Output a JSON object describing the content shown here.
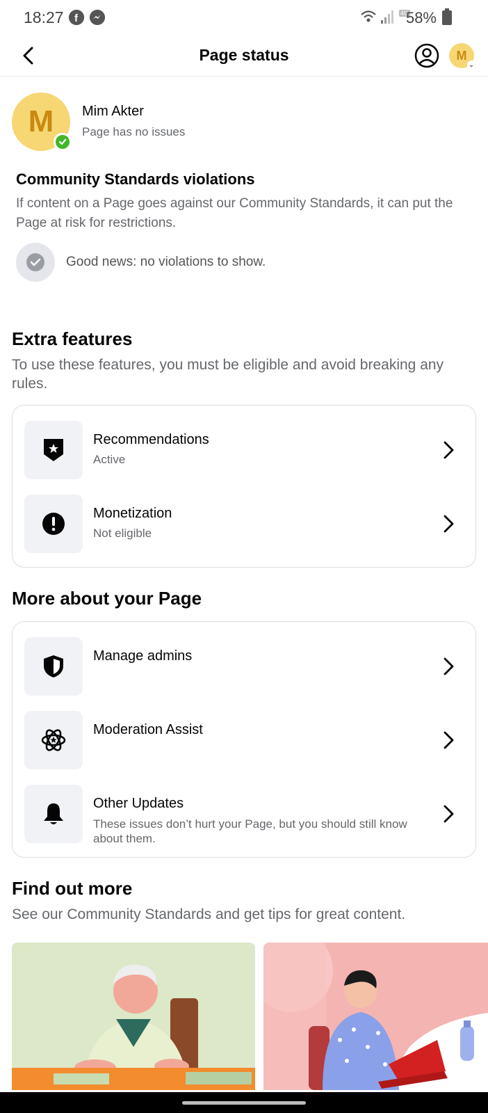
{
  "status_bar": {
    "time": "18:27",
    "battery_percent": "58%",
    "network_badge": "4G"
  },
  "nav": {
    "title": "Page status",
    "avatar_letter": "M"
  },
  "page": {
    "avatar_letter": "M",
    "name": "Mim Akter",
    "status": "Page has no issues"
  },
  "violations": {
    "title": "Community Standards violations",
    "description": "If content on a Page goes against our Community Standards, it can put the Page at risk for restrictions.",
    "empty_message": "Good news: no violations to show."
  },
  "extra_features": {
    "title": "Extra features",
    "description": "To use these features, you must be eligible and avoid breaking any rules.",
    "items": [
      {
        "title": "Recommendations",
        "subtitle": "Active",
        "icon": "star-shield-icon"
      },
      {
        "title": "Monetization",
        "subtitle": "Not eligible",
        "icon": "exclamation-circle-icon"
      }
    ]
  },
  "more_about": {
    "title": "More about your Page",
    "items": [
      {
        "title": "Manage admins",
        "subtitle": "",
        "icon": "shield-icon"
      },
      {
        "title": "Moderation Assist",
        "subtitle": "",
        "icon": "atom-star-icon"
      },
      {
        "title": "Other Updates",
        "subtitle": "These issues don’t hurt your Page, but you should still know about them.",
        "icon": "bell-icon"
      }
    ]
  },
  "find_out_more": {
    "title": "Find out more",
    "description": "See our Community Standards and get tips for great content."
  },
  "colors": {
    "avatar_bg": "#f7d774",
    "avatar_letter": "#c98a12",
    "verified_green": "#42b72a",
    "secondary_text": "#65676b",
    "icon_box_bg": "#f0f2f5"
  }
}
